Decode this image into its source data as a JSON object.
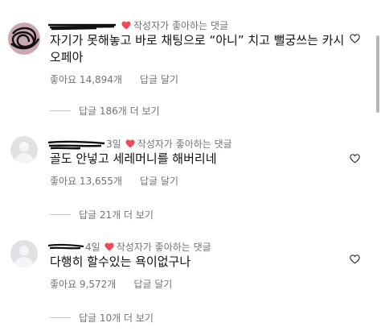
{
  "comments": [
    {
      "time": "",
      "pinned_label": "작성자가 좋아하는 댓글",
      "text_line1": "자기가 못해놓고 바로 채팅으로 “아니” 치고 뻘궁쓰는 카시",
      "text_line2": "오페아",
      "likes": "좋아요 14,894개",
      "reply_label": "답글 달기",
      "view_replies": "답글 186개 더 보기"
    },
    {
      "time": "3일",
      "pinned_label": "작성자가 좋아하는 댓글",
      "text_line1": "골도 안넣고 세레머니를 해버리네",
      "text_line2": "",
      "likes": "좋아요 13,655개",
      "reply_label": "답글 달기",
      "view_replies": "답글 21개 더 보기"
    },
    {
      "time": "4일",
      "pinned_label": "작성자가 좋아하는 댓글",
      "text_line1": "다행히 할수있는 욕이없구나",
      "text_line2": "",
      "likes": "좋아요 9,572개",
      "reply_label": "답글 달기",
      "view_replies": "답글 10개 더 보기"
    }
  ],
  "icons": {
    "pinned": "heart-filled-icon",
    "like": "heart-outline-icon"
  },
  "colors": {
    "heart": "#ed4956",
    "muted_text": "#737373",
    "scribble": "#111111"
  }
}
